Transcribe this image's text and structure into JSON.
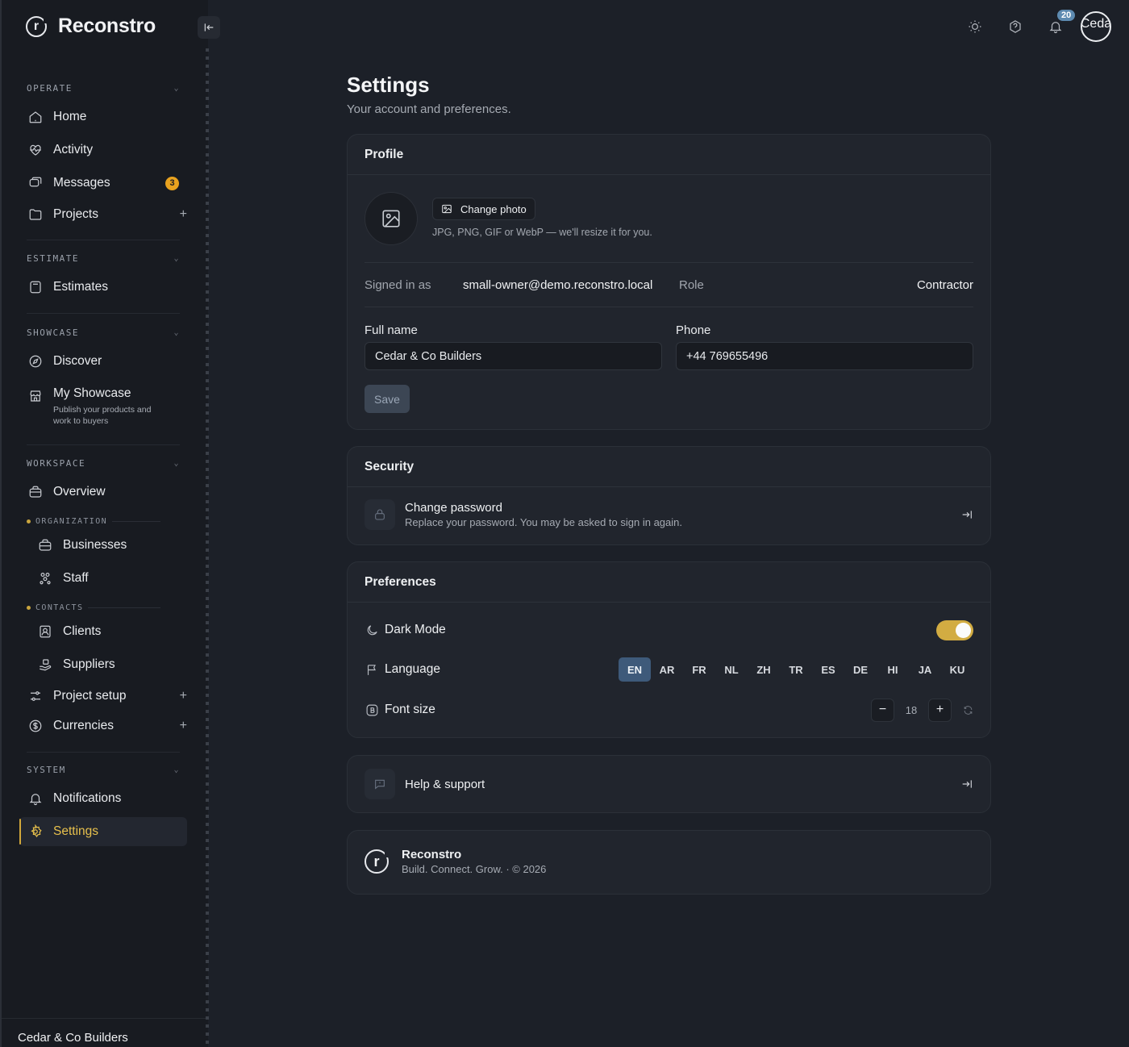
{
  "brand": {
    "name": "Reconstro",
    "logo_letter": "r"
  },
  "sidebar": {
    "sections": {
      "operate": "OPERATE",
      "estimate": "ESTIMATE",
      "showcase": "SHOWCASE",
      "workspace": "WORKSPACE",
      "organization": "ORGANIZATION",
      "contacts": "CONTACTS",
      "system": "SYSTEM"
    },
    "items": {
      "home": "Home",
      "activity": "Activity",
      "messages": "Messages",
      "messages_badge": "3",
      "projects": "Projects",
      "estimates": "Estimates",
      "discover": "Discover",
      "my_showcase": "My Showcase",
      "my_showcase_desc": "Publish your products and work to buyers",
      "overview": "Overview",
      "businesses": "Businesses",
      "staff": "Staff",
      "clients": "Clients",
      "suppliers": "Suppliers",
      "project_setup": "Project setup",
      "currencies": "Currencies",
      "notifications": "Notifications",
      "settings": "Settings"
    },
    "footer_name": "Cedar & Co Builders"
  },
  "topbar": {
    "notification_count": "20",
    "avatar_text": "Ceda"
  },
  "page": {
    "title": "Settings",
    "subtitle": "Your account and preferences."
  },
  "profile": {
    "heading": "Profile",
    "change_photo": "Change photo",
    "photo_hint": "JPG, PNG, GIF or WebP — we'll resize it for you.",
    "signed_in_label": "Signed in as",
    "signed_in_value": "small-owner@demo.reconstro.local",
    "role_label": "Role",
    "role_value": "Contractor",
    "full_name_label": "Full name",
    "full_name_value": "Cedar & Co Builders",
    "phone_label": "Phone",
    "phone_value": "+44 769655496",
    "save_label": "Save"
  },
  "security": {
    "heading": "Security",
    "change_password_title": "Change password",
    "change_password_desc": "Replace your password. You may be asked to sign in again."
  },
  "preferences": {
    "heading": "Preferences",
    "dark_mode_label": "Dark Mode",
    "dark_mode_on": true,
    "language_label": "Language",
    "languages": [
      "EN",
      "AR",
      "FR",
      "NL",
      "ZH",
      "TR",
      "ES",
      "DE",
      "HI",
      "JA",
      "KU"
    ],
    "selected_language": "EN",
    "font_size_label": "Font size",
    "font_size_value": "18"
  },
  "help": {
    "title": "Help & support"
  },
  "footer": {
    "name": "Reconstro",
    "tagline": "Build. Connect. Grow. · © 2026"
  },
  "colors": {
    "accent": "#d2ac42",
    "language_active": "#3e5a7a",
    "badge": "#e8a21f",
    "background": "#1c2028",
    "sidebar": "#181b21",
    "card": "#21252d"
  },
  "icons": [
    "home-icon",
    "activity-icon",
    "messages-icon",
    "folder-icon",
    "calculator-icon",
    "compass-icon",
    "storefront-icon",
    "overview-icon",
    "briefcase-icon",
    "staff-icon",
    "contact-card-icon",
    "supplier-icon",
    "sliders-icon",
    "currency-icon",
    "bell-icon",
    "gear-icon",
    "sun-icon",
    "help-icon",
    "image-icon",
    "lock-icon",
    "moon-icon",
    "flag-icon",
    "font-icon",
    "reset-icon",
    "chat-icon",
    "arrow-exit-icon",
    "collapse-icon"
  ]
}
